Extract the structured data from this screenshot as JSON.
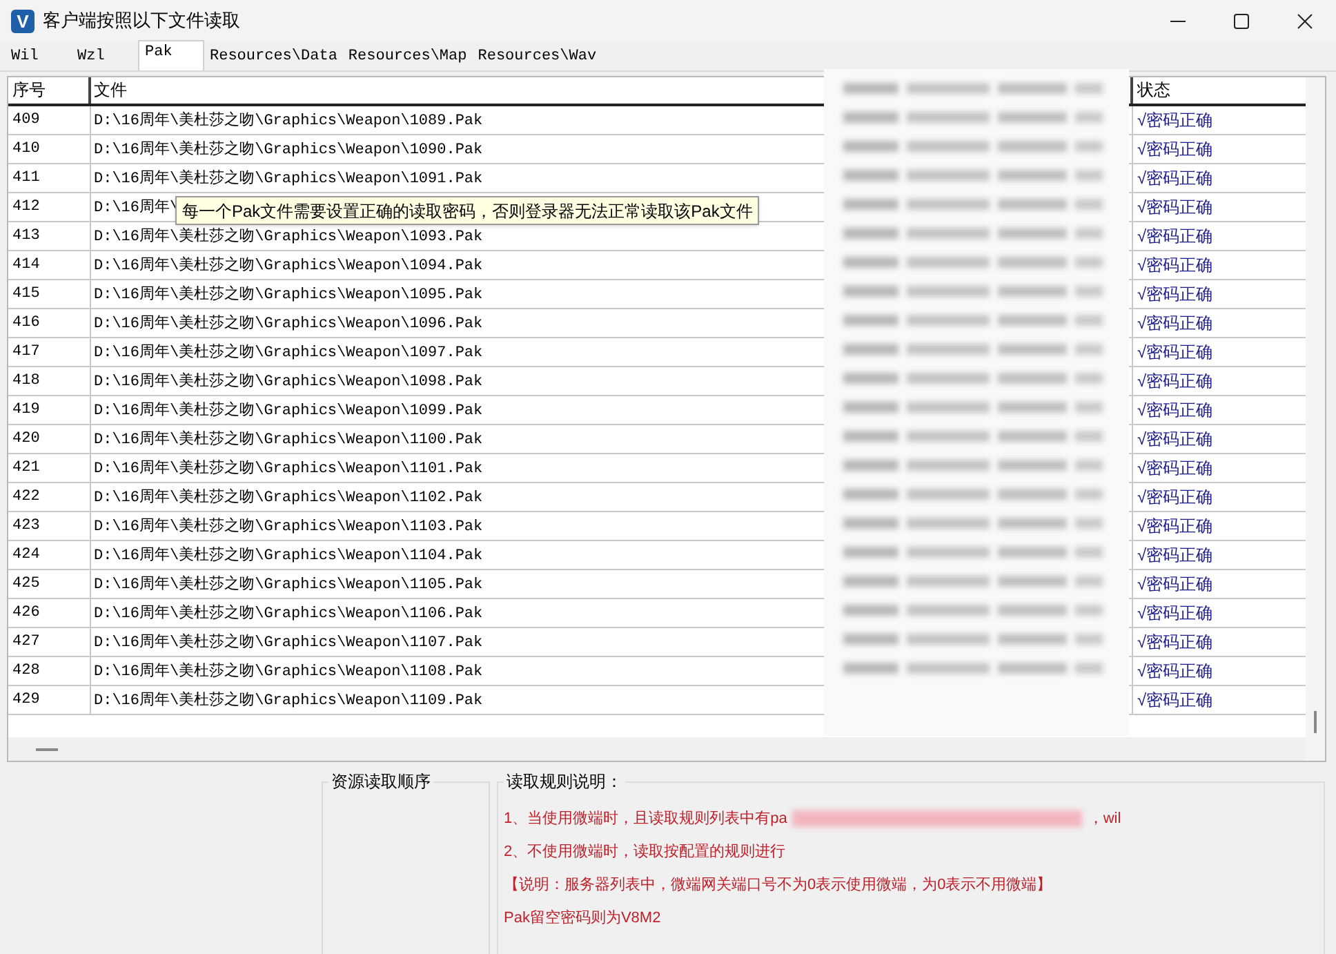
{
  "window": {
    "title": "客户端按照以下文件读取",
    "logo_letter": "V"
  },
  "tabs": [
    {
      "label": "Wil",
      "selected": false
    },
    {
      "label": "Wzl",
      "selected": false
    },
    {
      "label": "Pak",
      "selected": true
    },
    {
      "label": "Resources\\Data",
      "selected": false
    },
    {
      "label": "Resources\\Map",
      "selected": false
    },
    {
      "label": "Resources\\Wav",
      "selected": false
    }
  ],
  "table": {
    "columns": [
      "序号",
      "文件",
      "状态"
    ],
    "rows": [
      {
        "index": "409",
        "file": "D:\\16周年\\美杜莎之吻\\Graphics\\Weapon\\1089.Pak",
        "status": "√密码正确"
      },
      {
        "index": "410",
        "file": "D:\\16周年\\美杜莎之吻\\Graphics\\Weapon\\1090.Pak",
        "status": "√密码正确"
      },
      {
        "index": "411",
        "file": "D:\\16周年\\美杜莎之吻\\Graphics\\Weapon\\1091.Pak",
        "status": "√密码正确"
      },
      {
        "index": "412",
        "file": "D:\\16周年\\",
        "status": "√密码正确"
      },
      {
        "index": "413",
        "file": "D:\\16周年\\美杜莎之吻\\Graphics\\Weapon\\1093.Pak",
        "status": "√密码正确"
      },
      {
        "index": "414",
        "file": "D:\\16周年\\美杜莎之吻\\Graphics\\Weapon\\1094.Pak",
        "status": "√密码正确"
      },
      {
        "index": "415",
        "file": "D:\\16周年\\美杜莎之吻\\Graphics\\Weapon\\1095.Pak",
        "status": "√密码正确"
      },
      {
        "index": "416",
        "file": "D:\\16周年\\美杜莎之吻\\Graphics\\Weapon\\1096.Pak",
        "status": "√密码正确"
      },
      {
        "index": "417",
        "file": "D:\\16周年\\美杜莎之吻\\Graphics\\Weapon\\1097.Pak",
        "status": "√密码正确"
      },
      {
        "index": "418",
        "file": "D:\\16周年\\美杜莎之吻\\Graphics\\Weapon\\1098.Pak",
        "status": "√密码正确"
      },
      {
        "index": "419",
        "file": "D:\\16周年\\美杜莎之吻\\Graphics\\Weapon\\1099.Pak",
        "status": "√密码正确"
      },
      {
        "index": "420",
        "file": "D:\\16周年\\美杜莎之吻\\Graphics\\Weapon\\1100.Pak",
        "status": "√密码正确"
      },
      {
        "index": "421",
        "file": "D:\\16周年\\美杜莎之吻\\Graphics\\Weapon\\1101.Pak",
        "status": "√密码正确"
      },
      {
        "index": "422",
        "file": "D:\\16周年\\美杜莎之吻\\Graphics\\Weapon\\1102.Pak",
        "status": "√密码正确"
      },
      {
        "index": "423",
        "file": "D:\\16周年\\美杜莎之吻\\Graphics\\Weapon\\1103.Pak",
        "status": "√密码正确"
      },
      {
        "index": "424",
        "file": "D:\\16周年\\美杜莎之吻\\Graphics\\Weapon\\1104.Pak",
        "status": "√密码正确"
      },
      {
        "index": "425",
        "file": "D:\\16周年\\美杜莎之吻\\Graphics\\Weapon\\1105.Pak",
        "status": "√密码正确"
      },
      {
        "index": "426",
        "file": "D:\\16周年\\美杜莎之吻\\Graphics\\Weapon\\1106.Pak",
        "status": "√密码正确"
      },
      {
        "index": "427",
        "file": "D:\\16周年\\美杜莎之吻\\Graphics\\Weapon\\1107.Pak",
        "status": "√密码正确"
      },
      {
        "index": "428",
        "file": "D:\\16周年\\美杜莎之吻\\Graphics\\Weapon\\1108.Pak",
        "status": "√密码正确"
      },
      {
        "index": "429",
        "file": "D:\\16周年\\美杜莎之吻\\Graphics\\Weapon\\1109.Pak",
        "status": "√密码正确"
      }
    ]
  },
  "tooltip": "每一个Pak文件需要设置正确的读取密码，否则登录器无法正常读取该Pak文件",
  "order_panel": {
    "title": "资源读取顺序"
  },
  "rules_panel": {
    "title": "读取规则说明：",
    "lines": [
      {
        "text": "1、当使用微端时，且读取规则列表中有pa",
        "text_after": "，wil"
      },
      {
        "text": "2、不使用微端时，读取按配置的规则进行"
      },
      {
        "text": "【说明：服务器列表中，微端网关端口号不为0表示使用微端，为0表示不用微端】"
      },
      {
        "text": "Pak留空密码则为V8M2"
      }
    ]
  }
}
